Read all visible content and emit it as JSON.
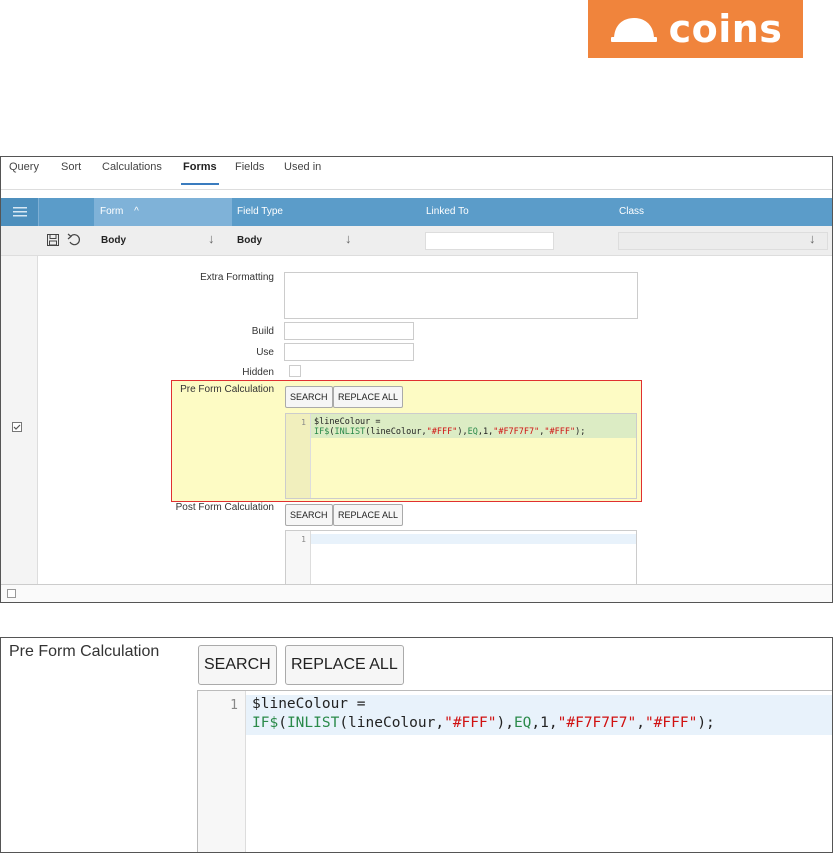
{
  "brand": {
    "logo_text": "coins",
    "logo_color": "#f0843c"
  },
  "tabs": [
    {
      "label": "Query",
      "active": false
    },
    {
      "label": "Sort",
      "active": false
    },
    {
      "label": "Calculations",
      "active": false
    },
    {
      "label": "Forms",
      "active": true
    },
    {
      "label": "Fields",
      "active": false
    },
    {
      "label": "Used in",
      "active": false
    }
  ],
  "grid": {
    "columns": [
      "Form",
      "Field Type",
      "Linked To",
      "Class"
    ],
    "sort_indicator": "^",
    "header_color": "#5b9cc9"
  },
  "filter_row": {
    "form_value": "Body",
    "field_type_value": "Body",
    "linked_to_value": "",
    "class_value": ""
  },
  "form": {
    "extra_formatting_label": "Extra Formatting",
    "build_label": "Build",
    "use_label": "Use",
    "hidden_label": "Hidden",
    "pre_form_label": "Pre Form Calculation",
    "post_form_label": "Post Form Calculation",
    "search_label": "SEARCH",
    "replace_all_label": "REPLACE ALL"
  },
  "pre_form_code": {
    "line_number": "1",
    "line1": "$lineColour =",
    "line2_fn1": "IF$",
    "line2_p1": "(",
    "line2_fn2": "INLIST",
    "line2_p2": "(lineColour,",
    "line2_s1": "\"#FFF\"",
    "line2_p3": "),",
    "line2_eq": "EQ",
    "line2_p4": ",1,",
    "line2_s2": "\"#F7F7F7\"",
    "line2_p5": ",",
    "line2_s3": "\"#FFF\"",
    "line2_p6": ");"
  },
  "post_form_code": {
    "line_number": "1"
  },
  "colors": {
    "highlight_fill": "#fdfbc4",
    "highlight_border": "#e03030",
    "keyword": "#2a8a4a",
    "string": "#d01010"
  }
}
